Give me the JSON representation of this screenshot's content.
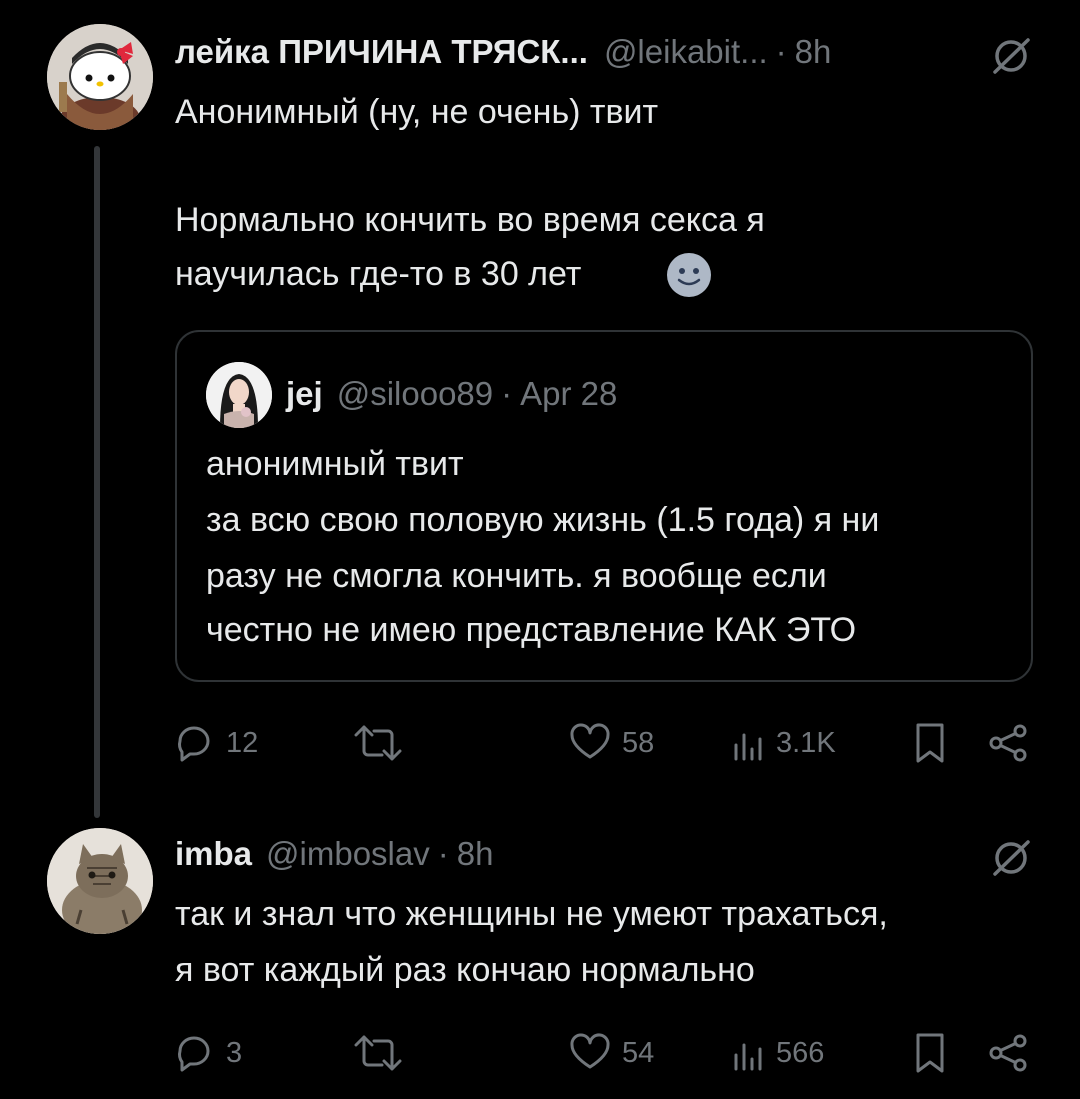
{
  "thread": {
    "main_post": {
      "display_name": "лейка ПРИЧИНА ТРЯСК...",
      "handle": "@leikabit...",
      "separator": "·",
      "time": "8h",
      "text_line1": "Анонимный (ну, не очень) твит",
      "text_line2": "Нормально кончить во время секса я",
      "text_line3": "научилась где-то в 30 лет",
      "emoji_icon": "slightly-smiling-face-icon",
      "quoted": {
        "display_name": "jej",
        "handle": "@silooo89",
        "separator": "·",
        "date": "Apr 28",
        "line1": "анонимный твит",
        "line2": "за всю свою половую жизнь (1.5 года) я ни",
        "line3": "разу не смогла кончить. я вообще если",
        "line4": "честно не имею представление КАК ЭТО"
      },
      "actions": {
        "replies": "12",
        "retweets": "",
        "likes": "58",
        "views": "3.1K"
      }
    },
    "reply_post": {
      "display_name": "imba",
      "handle": "@imboslav",
      "separator": "·",
      "time": "8h",
      "text_line1": "так и знал что женщины не умеют трахаться,",
      "text_line2": "я вот каждый раз кончаю нормально",
      "actions": {
        "replies": "3",
        "retweets": "",
        "likes": "54",
        "views": "566"
      }
    }
  },
  "colors": {
    "background": "#000000",
    "text": "#e7e9ea",
    "muted": "#71767b",
    "border": "#2f3336"
  },
  "icons": [
    "reply-icon",
    "retweet-icon",
    "like-icon",
    "views-icon",
    "bookmark-icon",
    "share-icon",
    "grok-icon"
  ]
}
